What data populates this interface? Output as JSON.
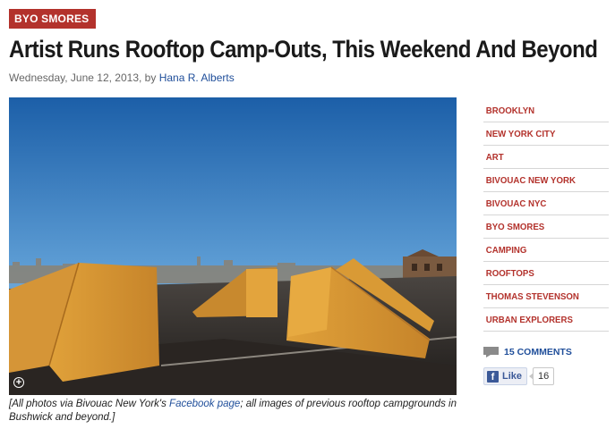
{
  "tag_label": "BYO SMORES",
  "headline": "Artist Runs Rooftop Camp-Outs, This Weekend And Beyond",
  "byline": {
    "date_prefix": "Wednesday, June 12, 2013, by",
    "author": "Hana R. Alberts"
  },
  "photo": {
    "icon": "zoom-plus-icon"
  },
  "caption": {
    "part1": "[All photos via Bivouac New York's ",
    "link": "Facebook page",
    "part2": "; all images of previous rooftop campgrounds in Bushwick and beyond.]"
  },
  "tags": [
    "BROOKLYN",
    "NEW YORK CITY",
    "ART",
    "BIVOUAC NEW YORK",
    "BIVOUAC NYC",
    "BYO SMORES",
    "CAMPING",
    "ROOFTOPS",
    "THOMAS STEVENSON",
    "URBAN EXPLORERS"
  ],
  "comments_label": "15 COMMENTS",
  "like": {
    "label": "Like",
    "count": "16"
  },
  "colors": {
    "accent_red": "#b3322c",
    "link_blue": "#1f4e9a",
    "facebook_blue": "#3b5998"
  }
}
